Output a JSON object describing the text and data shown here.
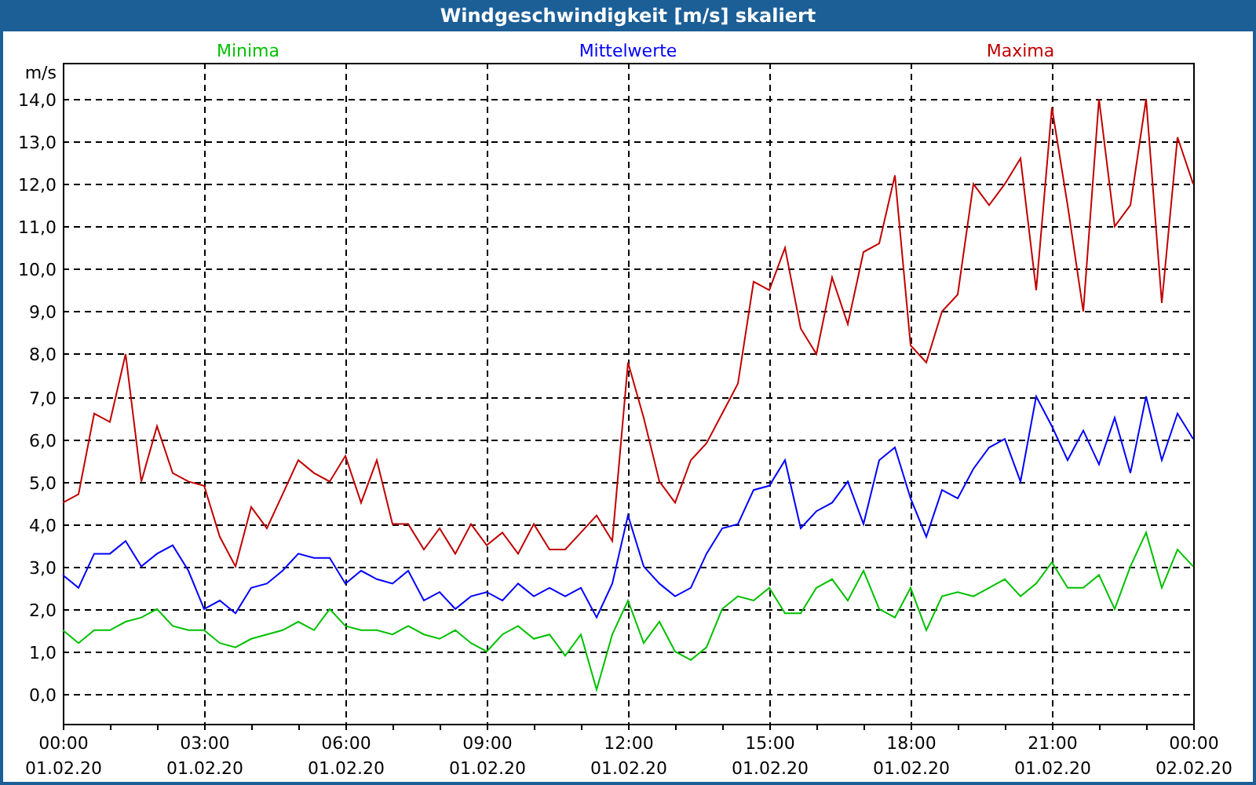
{
  "window": {
    "title": "Windgeschwindigkeit [m/s] skaliert"
  },
  "chart": {
    "chart_data": {
      "type": "line",
      "ylabel": "m/s",
      "categories": [
        "00:00 01.02.20",
        null,
        null,
        null,
        null,
        null,
        null,
        null,
        null,
        "03:00 01.02.20",
        null,
        null,
        null,
        null,
        null,
        null,
        null,
        null,
        "06:00 01.02.20",
        null,
        null,
        null,
        null,
        null,
        null,
        null,
        null,
        "09:00 01.02.20",
        null,
        null,
        null,
        null,
        null,
        null,
        null,
        null,
        "12:00 01.02.20",
        null,
        null,
        null,
        null,
        null,
        null,
        null,
        null,
        "15:00 01.02.20",
        null,
        null,
        null,
        null,
        null,
        null,
        null,
        null,
        "18:00 01.02.20",
        null,
        null,
        null,
        null,
        null,
        null,
        null,
        null,
        "21:00 01.02.20",
        null,
        null,
        null,
        null,
        null,
        null,
        null,
        null,
        "00:00 02.02.20"
      ],
      "series": [
        {
          "name": "Minima",
          "color": "#00c000",
          "values": [
            1.5,
            1.2,
            1.5,
            1.5,
            1.7,
            1.8,
            2.0,
            1.6,
            1.5,
            1.5,
            1.2,
            1.1,
            1.3,
            1.4,
            1.5,
            1.7,
            1.5,
            2.0,
            1.6,
            1.5,
            1.5,
            1.4,
            1.6,
            1.4,
            1.3,
            1.5,
            1.2,
            1.0,
            1.4,
            1.6,
            1.3,
            1.4,
            0.9,
            1.4,
            0.1,
            1.4,
            2.2,
            1.2,
            1.7,
            1.0,
            0.8,
            1.1,
            2.0,
            2.3,
            2.2,
            2.5,
            1.9,
            1.9,
            2.5,
            2.7,
            2.2,
            2.9,
            2.0,
            1.8,
            2.5,
            1.5,
            2.3,
            2.4,
            2.3,
            2.5,
            2.7,
            2.3,
            2.6,
            3.1,
            2.5,
            2.5,
            2.8,
            2.0,
            3.0,
            3.8,
            2.5,
            3.4,
            3.0
          ]
        },
        {
          "name": "Mittelwerte",
          "color": "#0000ff",
          "values": [
            2.8,
            2.5,
            3.3,
            3.3,
            3.6,
            3.0,
            3.3,
            3.5,
            2.9,
            2.0,
            2.2,
            1.9,
            2.5,
            2.6,
            2.9,
            3.3,
            3.2,
            3.2,
            2.6,
            2.9,
            2.7,
            2.6,
            2.9,
            2.2,
            2.4,
            2.0,
            2.3,
            2.4,
            2.2,
            2.6,
            2.3,
            2.5,
            2.3,
            2.5,
            1.8,
            2.6,
            4.2,
            3.0,
            2.6,
            2.3,
            2.5,
            3.3,
            3.9,
            4.0,
            4.8,
            4.9,
            5.5,
            3.9,
            4.3,
            4.5,
            5.0,
            4.0,
            5.5,
            5.8,
            4.6,
            3.7,
            4.8,
            4.6,
            5.3,
            5.8,
            6.0,
            5.0,
            7.0,
            6.3,
            5.5,
            6.2,
            5.4,
            6.5,
            5.2,
            7.0,
            5.5,
            6.6,
            6.0
          ]
        },
        {
          "name": "Maxima",
          "color": "#c00000",
          "values": [
            4.5,
            4.7,
            6.6,
            6.4,
            8.0,
            5.0,
            6.3,
            5.2,
            5.0,
            4.9,
            3.7,
            3.0,
            4.4,
            3.9,
            4.7,
            5.5,
            5.2,
            5.0,
            5.6,
            4.5,
            5.5,
            4.0,
            4.0,
            3.4,
            3.9,
            3.3,
            4.0,
            3.5,
            3.8,
            3.3,
            4.0,
            3.4,
            3.4,
            3.8,
            4.2,
            3.6,
            7.8,
            6.5,
            5.0,
            4.5,
            5.5,
            5.9,
            6.6,
            7.3,
            9.7,
            9.5,
            10.5,
            8.6,
            8.0,
            9.8,
            8.7,
            10.4,
            10.6,
            12.2,
            8.2,
            7.8,
            9.0,
            9.4,
            12.0,
            11.5,
            12.0,
            12.6,
            9.5,
            13.8,
            11.5,
            9.0,
            14.0,
            11.0,
            11.5,
            14.0,
            9.2,
            13.1,
            12.0
          ]
        }
      ],
      "ylim": [
        -0.7,
        14.85
      ],
      "grid": true,
      "yticks": [
        {
          "value": 0,
          "label": "0,0"
        },
        {
          "value": 1,
          "label": "1,0"
        },
        {
          "value": 2,
          "label": "2,0"
        },
        {
          "value": 3,
          "label": "3,0"
        },
        {
          "value": 4,
          "label": "4,0"
        },
        {
          "value": 5,
          "label": "5,0"
        },
        {
          "value": 6,
          "label": "6,0"
        },
        {
          "value": 7,
          "label": "7,0"
        },
        {
          "value": 8,
          "label": "8,0"
        },
        {
          "value": 9,
          "label": "9,0"
        },
        {
          "value": 10,
          "label": "10,0"
        },
        {
          "value": 11,
          "label": "11,0"
        },
        {
          "value": 12,
          "label": "12,0"
        },
        {
          "value": 13,
          "label": "13,0"
        },
        {
          "value": 14,
          "label": "14,0"
        }
      ]
    }
  }
}
